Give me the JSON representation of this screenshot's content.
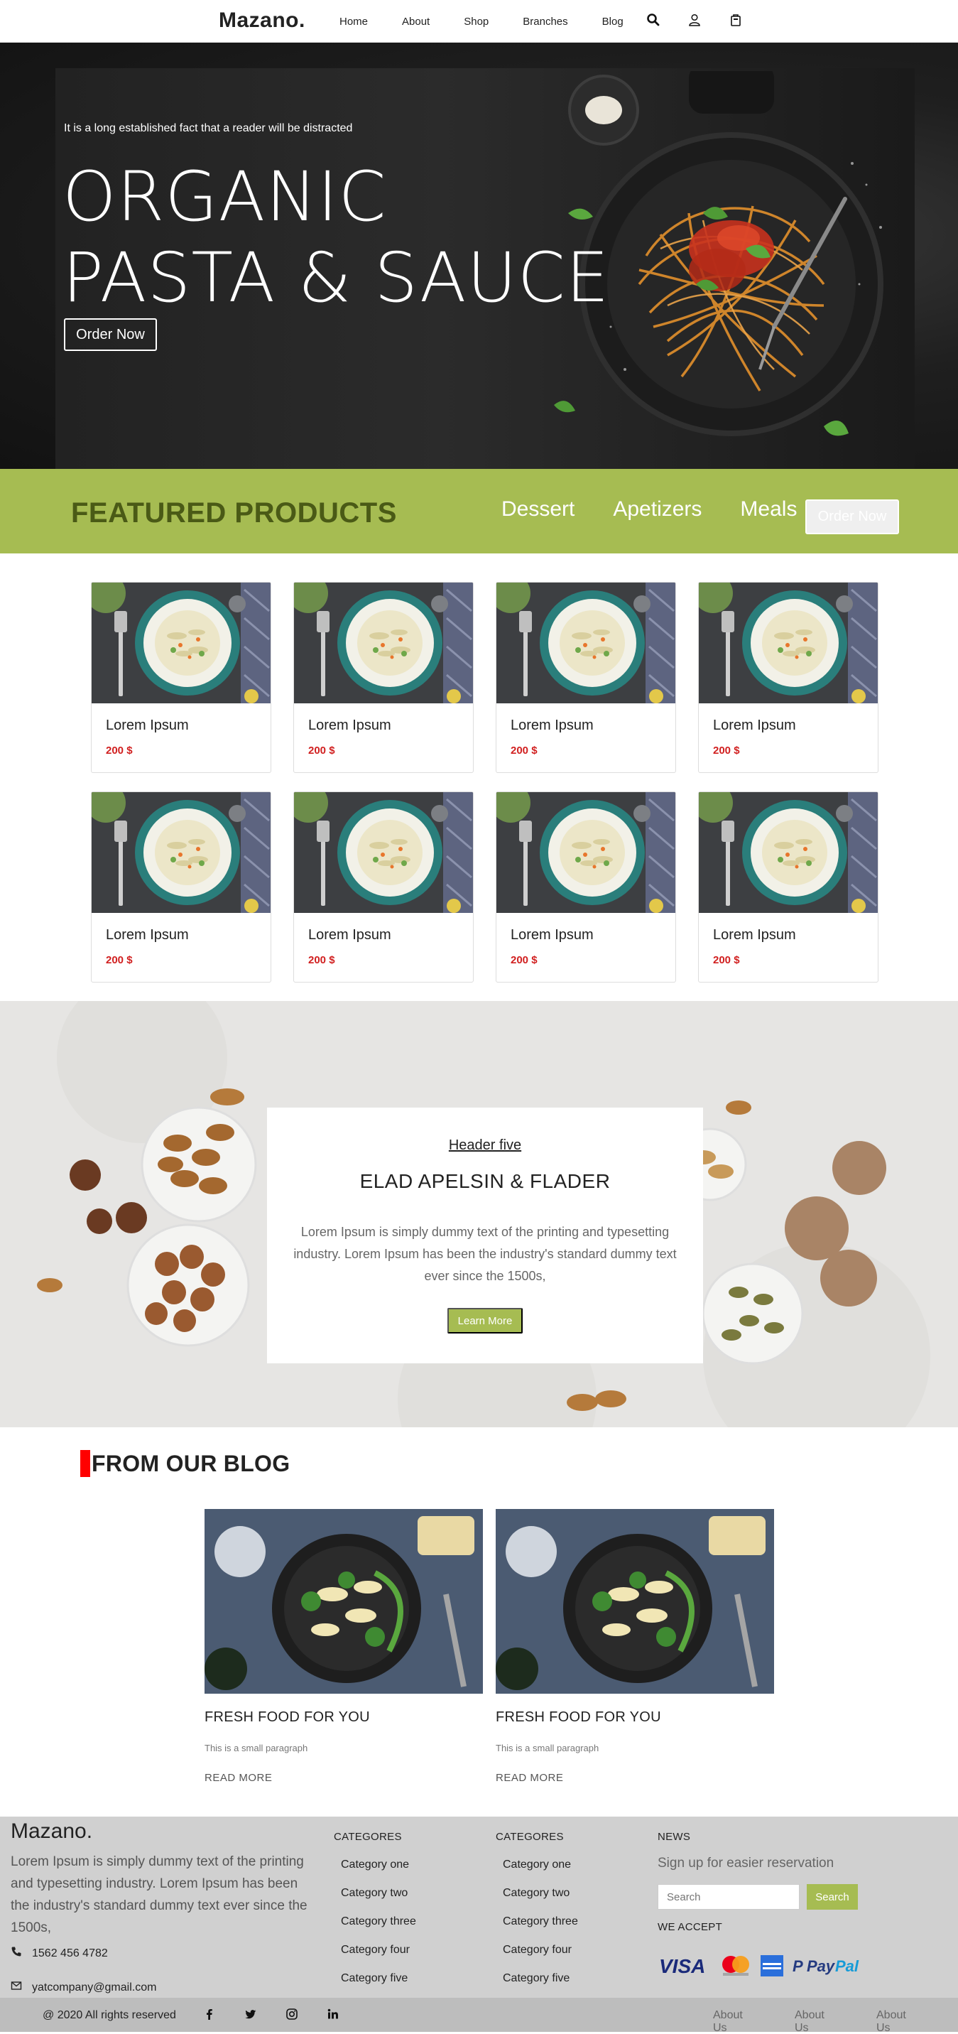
{
  "nav": {
    "brand": "Mazano.",
    "links": [
      "Home",
      "About",
      "Shop",
      "Branches",
      "Blog"
    ],
    "icons": [
      "search-icon",
      "user-icon",
      "cart-icon"
    ]
  },
  "hero": {
    "tagline": "It is a long established fact that a reader will be distracted",
    "title_line1": "ORGANIC",
    "title_line2": "PASTA & SAUCE",
    "button": "Order Now"
  },
  "featured": {
    "title": "FEATURED PRODUCTS",
    "tabs": [
      "Dessert",
      "Apetizers",
      "Meals"
    ],
    "button": "Order Now"
  },
  "products": [
    {
      "name": "Lorem Ipsum",
      "price": "200 $"
    },
    {
      "name": "Lorem Ipsum",
      "price": "200 $"
    },
    {
      "name": "Lorem Ipsum",
      "price": "200 $"
    },
    {
      "name": "Lorem Ipsum",
      "price": "200 $"
    },
    {
      "name": "Lorem Ipsum",
      "price": "200 $"
    },
    {
      "name": "Lorem Ipsum",
      "price": "200 $"
    },
    {
      "name": "Lorem Ipsum",
      "price": "200 $"
    },
    {
      "name": "Lorem Ipsum",
      "price": "200 $"
    }
  ],
  "feature_box": {
    "header": "Header five",
    "title": "ELAD APELSIN & FLADER",
    "text": "Lorem Ipsum is simply dummy text of the printing and typesetting industry. Lorem Ipsum has been the industry's standard dummy text ever since the 1500s,",
    "button": "Learn More"
  },
  "blog": {
    "title": "FROM OUR BLOG",
    "posts": [
      {
        "title": "FRESH FOOD FOR YOU",
        "desc": "This is a small paragraph",
        "more": "READ MORE"
      },
      {
        "title": "FRESH FOOD FOR YOU",
        "desc": "This is a small paragraph",
        "more": "READ MORE"
      }
    ]
  },
  "footer": {
    "brand": "Mazano.",
    "about": "Lorem Ipsum is simply dummy text of the printing and typesetting industry. Lorem Ipsum has been the industry's standard dummy text ever since the 1500s,",
    "phone": "1562 456 4782",
    "email": "yatcompany@gmail.com",
    "col1": {
      "title": "CATEGORES",
      "items": [
        "Category one",
        "Category two",
        "Category three",
        "Category four",
        "Category five"
      ]
    },
    "col2": {
      "title": "CATEGORES",
      "items": [
        "Category one",
        "Category two",
        "Category three",
        "Category four",
        "Category five"
      ]
    },
    "news": {
      "title": "NEWS",
      "subtitle": "Sign up for easier reservation",
      "placeholder": "Search",
      "button": "Search",
      "accept": "WE ACCEPT",
      "payments": [
        "VISA",
        "Mastercard",
        "American Express",
        "PayPal"
      ]
    },
    "copyright": "@ 2020 All rights reserved",
    "socials": [
      "facebook-icon",
      "twitter-icon",
      "instagram-icon",
      "linkedin-icon"
    ],
    "bottom_links": [
      "About Us",
      "About Us",
      "About Us"
    ]
  },
  "colors": {
    "accent_green": "#a6bc52",
    "dark_green_text": "#4a5a16",
    "price_red": "#d12020",
    "blog_marker_red": "#ff0000"
  }
}
